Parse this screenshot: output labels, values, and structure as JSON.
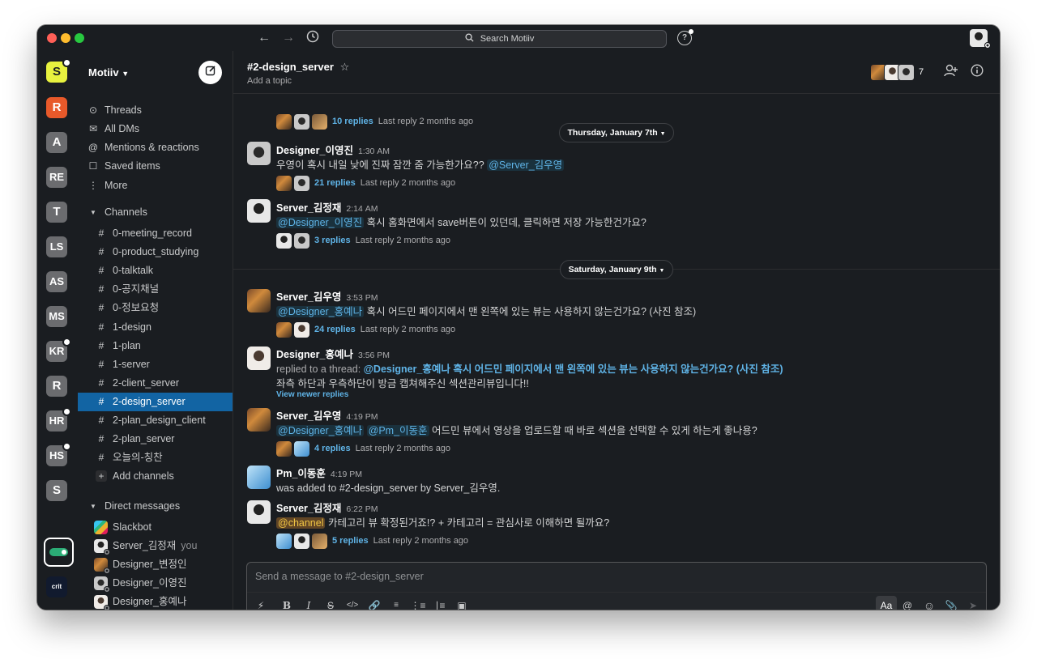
{
  "window": {
    "search_placeholder": "Search Motiiv",
    "help_glyph": "?",
    "traffic_lights": [
      "#ff5f57",
      "#febc2e",
      "#28c840"
    ]
  },
  "rail": {
    "workspaces": [
      {
        "label": "S",
        "color": "#e8f23f",
        "text_color": "#1a1d21",
        "dot": true
      },
      {
        "label": "R",
        "color": "#e8592a",
        "text_color": "#ffffff",
        "dot": false
      },
      {
        "label": "A",
        "color": "#6b6c6f",
        "text_color": "#ffffff",
        "dot": false
      },
      {
        "label": "RE",
        "color": "#6b6c6f",
        "text_color": "#ffffff",
        "dot": false
      },
      {
        "label": "T",
        "color": "#6b6c6f",
        "text_color": "#ffffff",
        "dot": false
      },
      {
        "label": "LS",
        "color": "#6b6c6f",
        "text_color": "#ffffff",
        "dot": false
      },
      {
        "label": "AS",
        "color": "#6b6c6f",
        "text_color": "#ffffff",
        "dot": false
      },
      {
        "label": "MS",
        "color": "#6b6c6f",
        "text_color": "#ffffff",
        "dot": false
      },
      {
        "label": "KR",
        "color": "#6b6c6f",
        "text_color": "#ffffff",
        "dot": true
      },
      {
        "label": "R",
        "color": "#6b6c6f",
        "text_color": "#ffffff",
        "dot": false
      },
      {
        "label": "HR",
        "color": "#6b6c6f",
        "text_color": "#ffffff",
        "dot": true
      },
      {
        "label": "HS",
        "color": "#6b6c6f",
        "text_color": "#ffffff",
        "dot": true
      },
      {
        "label": "S",
        "color": "#6b6c6f",
        "text_color": "#ffffff",
        "dot": false
      }
    ],
    "crit_label": "crit",
    "add_label": "+"
  },
  "sidebar": {
    "workspace_name": "Motiiv",
    "nav": [
      {
        "icon": "threads-icon",
        "glyph": "⊙",
        "label": "Threads"
      },
      {
        "icon": "dms-icon",
        "glyph": "✉",
        "label": "All DMs"
      },
      {
        "icon": "mention-icon",
        "glyph": "@",
        "label": "Mentions & reactions"
      },
      {
        "icon": "bookmark-icon",
        "glyph": "☐",
        "label": "Saved items"
      },
      {
        "icon": "more-icon",
        "glyph": "⋮",
        "label": "More"
      }
    ],
    "channels_header": "Channels",
    "channels": [
      "0-meeting_record",
      "0-product_studying",
      "0-talktalk",
      "0-공지채널",
      "0-정보요청",
      "1-design",
      "1-plan",
      "1-server",
      "2-client_server",
      "2-design_server",
      "2-plan_design_client",
      "2-plan_server",
      "오늘의-칭찬"
    ],
    "active_channel": "2-design_server",
    "add_channels": "Add channels",
    "dm_header": "Direct messages",
    "dms": [
      {
        "name": "Slackbot",
        "you": "",
        "avatar": "slackbot"
      },
      {
        "name": "Server_김정재",
        "you": "you",
        "avatar": "c"
      },
      {
        "name": "Designer_변정인",
        "you": "",
        "avatar": "a"
      },
      {
        "name": "Designer_이영진",
        "you": "",
        "avatar": "b"
      },
      {
        "name": "Designer_홍예나",
        "you": "",
        "avatar": "d"
      }
    ]
  },
  "header": {
    "channel": "#2-design_server",
    "topic": "Add a topic",
    "member_count": "7"
  },
  "messages": {
    "thread0": {
      "replies": "10 replies",
      "last": "Last reply 2 months ago"
    },
    "date1": "Thursday, January 7th",
    "m1": {
      "name": "Designer_이영진",
      "time": "1:30 AM",
      "text": "우영이 혹시 내일 낮에 진짜 잠깐 줌 가능한가요??",
      "mention": "@Server_김우영",
      "replies": "21 replies",
      "last": "Last reply 2 months ago"
    },
    "m2": {
      "name": "Server_김정재",
      "time": "2:14 AM",
      "mention": "@Designer_이영진",
      "text": "혹시 홈화면에서 save버튼이 있던데, 클릭하면 저장 가능한건가요?",
      "replies": "3 replies",
      "last": "Last reply 2 months ago"
    },
    "date2": "Saturday, January 9th",
    "m3": {
      "name": "Server_김우영",
      "time": "3:53 PM",
      "mention": "@Designer_홍예나",
      "text": "혹시 어드민 페이지에서 맨 왼쪽에 있는 뷰는 사용하지 않는건가요? (사진 참조)",
      "replies": "24 replies",
      "last": "Last reply 2 months ago"
    },
    "m4": {
      "name": "Designer_홍예나",
      "time": "3:56 PM",
      "replied_prefix": "replied to a thread:",
      "replied_link": "@Designer_홍예나 혹시 어드민 페이지에서 맨 왼쪽에 있는 뷰는 사용하지 않는건가요? (사진 참조)",
      "text": "좌측 하단과 우측하단이 방금 캡쳐해주신 섹션관리뷰입니다!!",
      "newer": "View newer replies"
    },
    "m5": {
      "name": "Server_김우영",
      "time": "4:19 PM",
      "mention1": "@Designer_홍예나",
      "mention2": "@Pm_이동훈",
      "text": "어드민 뷰에서 영상을 업로드할 때 바로 섹션을 선택할 수 있게 하는게 좋나용?",
      "replies": "4 replies",
      "last": "Last reply 2 months ago"
    },
    "m6": {
      "name": "Pm_이동훈",
      "time": "4:19 PM",
      "text": "was added to #2-design_server by Server_김우영."
    },
    "m7": {
      "name": "Server_김정재",
      "time": "6:22 PM",
      "mention": "@channel",
      "text": "카테고리 뷰 확정된거죠!? + 카테고리 = 관심사로 이해하면 될까요?",
      "replies": "5 replies",
      "last": "Last reply 2 months ago"
    }
  },
  "composer": {
    "placeholder": "Send a message to #2-design_server",
    "aa": "Aa"
  }
}
